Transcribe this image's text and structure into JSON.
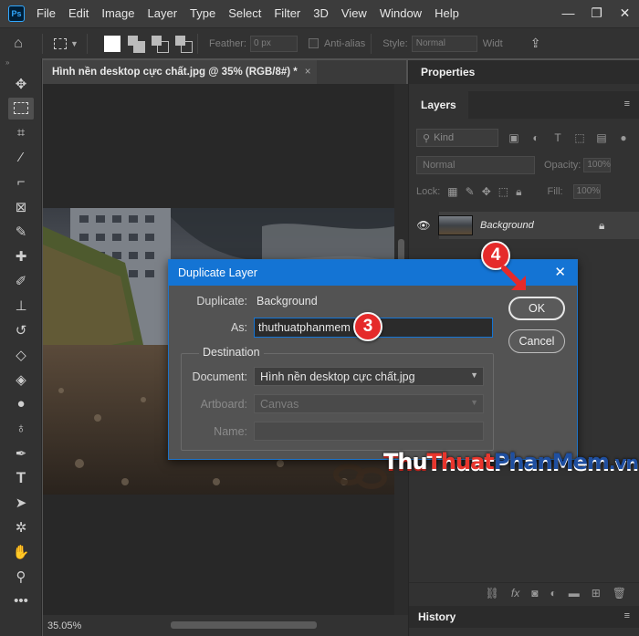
{
  "app": {
    "logo": "Ps",
    "menu": [
      "File",
      "Edit",
      "Image",
      "Layer",
      "Type",
      "Select",
      "Filter",
      "3D",
      "View",
      "Window",
      "Help"
    ],
    "window_controls": [
      "—",
      "❐",
      "✕"
    ]
  },
  "options": {
    "feather_label": "Feather:",
    "feather_value": "0 px",
    "antialias_label": "Anti-alias",
    "style_label": "Style:",
    "style_value": "Normal",
    "width_label": "Widt"
  },
  "document": {
    "tab_title": "Hình nền desktop cực chất.jpg @ 35% (RGB/8#) *",
    "tab_close": "×",
    "zoom": "35.05%"
  },
  "panels": {
    "properties_title": "Properties",
    "layers_title": "Layers",
    "kind_label": "Kind",
    "blend_mode": "Normal",
    "opacity_label": "Opacity:",
    "opacity_value": "100%",
    "lock_label": "Lock:",
    "fill_label": "Fill:",
    "fill_value": "100%",
    "layer_name": "Background",
    "history_title": "History"
  },
  "dialog": {
    "title": "Duplicate Layer",
    "duplicate_label": "Duplicate:",
    "duplicate_value": "Background",
    "as_label": "As:",
    "as_value": "thuthuatphanmem",
    "destination_label": "Destination",
    "document_label": "Document:",
    "document_value": "Hình nền desktop cực chất.jpg",
    "artboard_label": "Artboard:",
    "artboard_value": "Canvas",
    "name_label": "Name:",
    "ok_label": "OK",
    "cancel_label": "Cancel"
  },
  "annotations": {
    "step3": "3",
    "step4": "4"
  },
  "watermark": {
    "part1": "Thu",
    "part2": "Thuat",
    "part3": "PhanMem",
    "part4": ".vn"
  },
  "colors": {
    "accent": "#1474d4",
    "step_marker": "#e52a2a"
  }
}
